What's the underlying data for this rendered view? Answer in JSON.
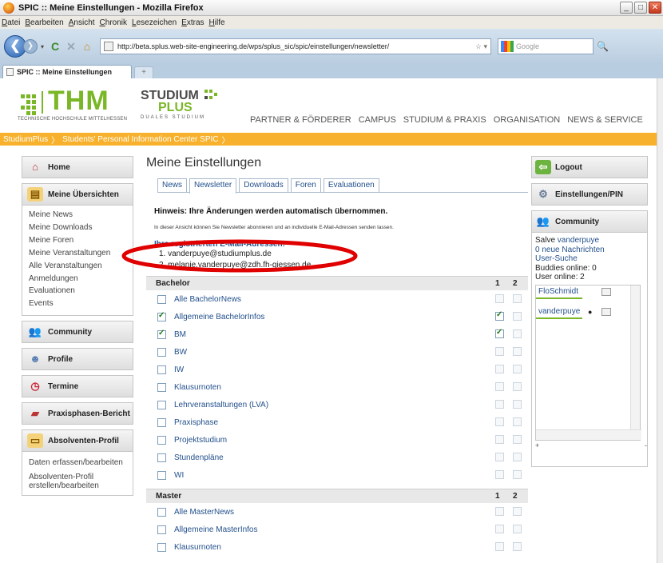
{
  "window": {
    "title": "SPIC :: Meine Einstellungen - Mozilla Firefox",
    "minimize": "_",
    "maximize": "□",
    "close": "✕"
  },
  "menu": [
    "Datei",
    "Bearbeiten",
    "Ansicht",
    "Chronik",
    "Lesezeichen",
    "Extras",
    "Hilfe"
  ],
  "nav": {
    "back": "❮",
    "forward": "❯",
    "dropdown": "▾",
    "reload": "C",
    "stop": "✕",
    "home": "⌂",
    "url": "http://beta.splus.web-site-engineering.de/wps/splus_sic/spic/einstellungen/newsletter/",
    "bookmark_star": "☆ ▾",
    "search_placeholder": "Google",
    "search_go": "🔍"
  },
  "tabs": {
    "active": "SPIC :: Meine Einstellungen",
    "new_tab": "+"
  },
  "header": {
    "thm": "THM",
    "thm_sub": "TECHNISCHE HOCHSCHULE MITTELHESSEN",
    "sp_top": "STUDIUM",
    "sp_plus": "PLUS",
    "sp_sub": "DUALES STUDIUM",
    "topnav": [
      "PARTNER & FÖRDERER",
      "CAMPUS",
      "STUDIUM & PRAXIS",
      "ORGANISATION",
      "NEWS & SERVICE"
    ]
  },
  "breadcrumb": {
    "items": [
      "StudiumPlus",
      "Students' Personal Information Center SPIC"
    ],
    "separator": "〉"
  },
  "left": {
    "home": "Home",
    "meine_uebersichten": "Meine Übersichten",
    "sub_items": [
      "Meine News",
      "Meine Downloads",
      "Meine Foren",
      "Meine Veranstaltungen",
      "Alle Veranstaltungen",
      "Anmeldungen",
      "Evaluationen",
      "Events"
    ],
    "community": "Community",
    "profile": "Profile",
    "termine": "Termine",
    "praxisbericht": "Praxisphasen-Bericht",
    "absolventen": "Absolventen-Profil",
    "absolventen_items": [
      "Daten erfassen/bearbeiten",
      "Absolventen-Profil erstellen/bearbeiten"
    ]
  },
  "main": {
    "title": "Meine Einstellungen",
    "tabs": [
      "News",
      "Newsletter",
      "Downloads",
      "Foren",
      "Evaluationen"
    ],
    "hint": "Hinweis: Ihre Änderungen werden automatisch übernommen.",
    "note": "In dieser Ansicht können Sie Newsletter abonnieren und an individuelle E-Mail-Adressen senden lassen.",
    "reg_title": "Ihre registrierten E-Mail-Adressen:",
    "emails": [
      "1.  vanderpuye@studiumplus.de",
      "2.  melanie.vanderpuye@zdh.fh-giessen.de"
    ],
    "col1": "1",
    "col2": "2",
    "bachelor_head": "Bachelor",
    "bachelor": [
      {
        "label": "Alle BachelorNews",
        "checked": false,
        "c1": false,
        "c2": false
      },
      {
        "label": "Allgemeine BachelorInfos",
        "checked": true,
        "c1": true,
        "c2": false
      },
      {
        "label": "BM",
        "checked": true,
        "c1": true,
        "c2": false
      },
      {
        "label": "BW",
        "checked": false,
        "c1": false,
        "c2": false
      },
      {
        "label": "IW",
        "checked": false,
        "c1": false,
        "c2": false
      },
      {
        "label": "Klausurnoten",
        "checked": false,
        "c1": false,
        "c2": false
      },
      {
        "label": "Lehrveranstaltungen (LVA)",
        "checked": false,
        "c1": false,
        "c2": false
      },
      {
        "label": "Praxisphase",
        "checked": false,
        "c1": false,
        "c2": false
      },
      {
        "label": "Projektstudium",
        "checked": false,
        "c1": false,
        "c2": false
      },
      {
        "label": "Stundenpläne",
        "checked": false,
        "c1": false,
        "c2": false
      },
      {
        "label": "WI",
        "checked": false,
        "c1": false,
        "c2": false
      }
    ],
    "master_head": "Master",
    "master": [
      {
        "label": "Alle MasterNews",
        "checked": false,
        "c1": false,
        "c2": false
      },
      {
        "label": "Allgemeine MasterInfos",
        "checked": false,
        "c1": false,
        "c2": false
      },
      {
        "label": "Klausurnoten",
        "checked": false,
        "c1": false,
        "c2": false
      }
    ]
  },
  "right": {
    "logout": "Logout",
    "settings": "Einstellungen/PIN",
    "community": "Community",
    "salve": "Salve",
    "user": "vanderpuye",
    "new_messages": "0 neue Nachrichten",
    "user_search": "User-Suche",
    "buddies_online": "Buddies online: 0",
    "user_online": "User online: 2",
    "buddies": [
      "FloSchmidt",
      "vanderpuye"
    ],
    "plus": "+",
    "minus": "-"
  },
  "colors": {
    "accent_green": "#7ab726",
    "breadcrumb_orange": "#f7b12d",
    "link_blue": "#23508c",
    "highlight_red": "#e00000"
  }
}
